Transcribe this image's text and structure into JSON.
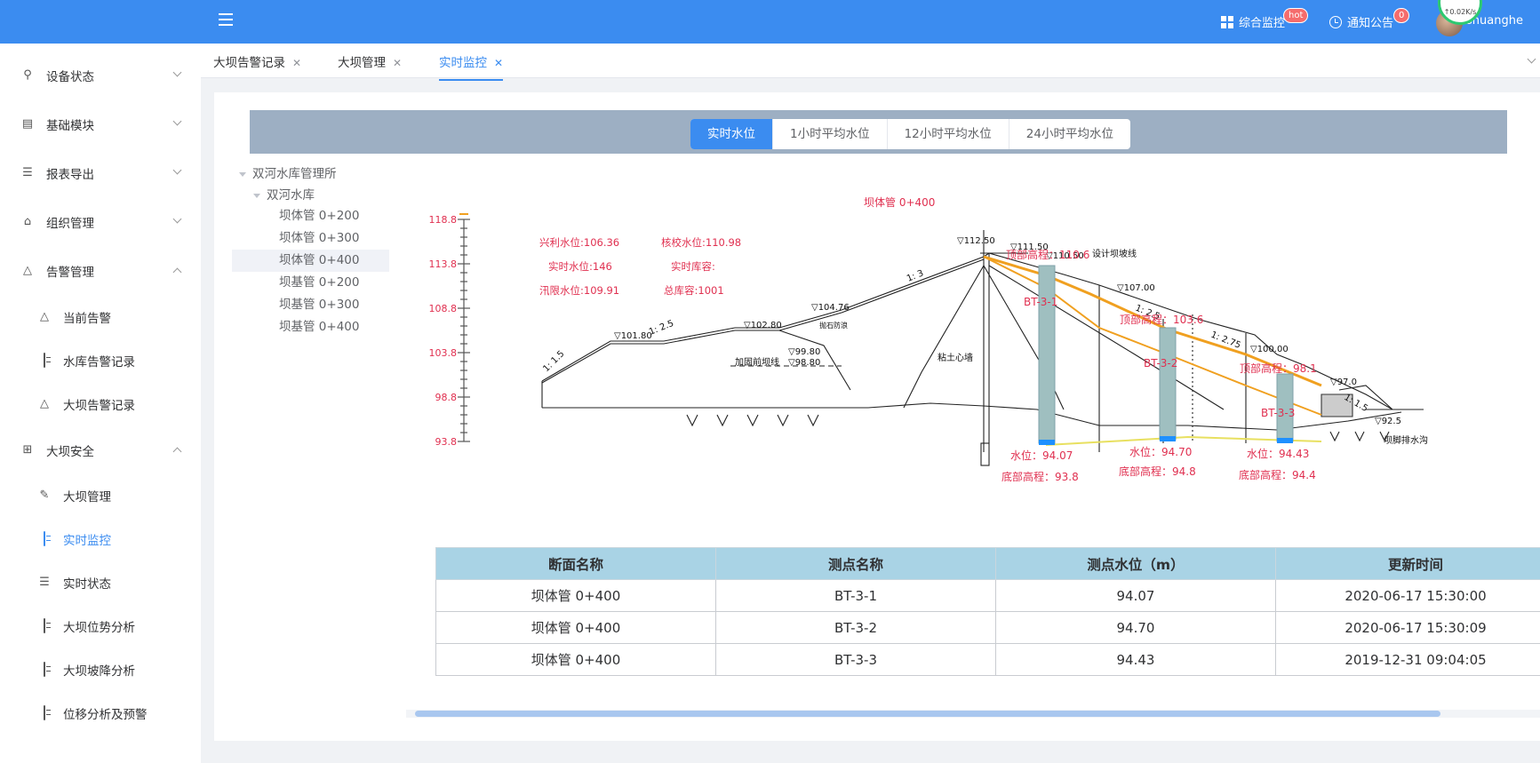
{
  "header": {
    "menu_icon": "hamburger-icon",
    "monitor_label": "综合监控",
    "monitor_badge": "hot",
    "notice_label": "通知公告",
    "notice_badge": "0",
    "username": "shuanghe",
    "net_speed": "↑0.02K/s",
    "brand_color": "#3b8cf0"
  },
  "sidebar": {
    "items": [
      {
        "label": "设备状态",
        "icon": "device-icon"
      },
      {
        "label": "基础模块",
        "icon": "module-icon"
      },
      {
        "label": "报表导出",
        "icon": "list-icon"
      },
      {
        "label": "组织管理",
        "icon": "org-icon"
      },
      {
        "label": "告警管理",
        "icon": "bell-icon"
      },
      {
        "label": "当前告警",
        "icon": "bell-icon"
      },
      {
        "label": "水库告警记录",
        "icon": "doc-icon"
      },
      {
        "label": "大坝告警记录",
        "icon": "bell-icon"
      },
      {
        "label": "大坝安全",
        "icon": "grid-icon"
      },
      {
        "label": "大坝管理",
        "icon": "edit-icon"
      },
      {
        "label": "实时监控",
        "icon": "doc-icon"
      },
      {
        "label": "实时状态",
        "icon": "list-icon"
      },
      {
        "label": "大坝位势分析",
        "icon": "doc-icon"
      },
      {
        "label": "大坝坡降分析",
        "icon": "doc-icon"
      },
      {
        "label": "位移分析及预警",
        "icon": "doc-icon"
      }
    ]
  },
  "tabs": [
    {
      "label": "大坝告警记录"
    },
    {
      "label": "大坝管理"
    },
    {
      "label": "实时监控"
    }
  ],
  "water_tabs": [
    "实时水位",
    "1小时平均水位",
    "12小时平均水位",
    "24小时平均水位"
  ],
  "tree": {
    "root": "双河水库管理所",
    "child": "双河水库",
    "leaves": [
      "坝体管 0+200",
      "坝体管 0+300",
      "坝体管 0+400",
      "坝基管 0+200",
      "坝基管 0+300",
      "坝基管 0+400"
    ]
  },
  "diagram": {
    "title": "坝体管 0+400",
    "scale_ticks": [
      "118.8",
      "113.8",
      "108.8",
      "103.8",
      "98.8",
      "93.8"
    ],
    "info": {
      "xingli": "兴利水位:106.36",
      "jiaohe": "核校水位:110.98",
      "shishi": "实时水位:146",
      "kurong": "实时库容:",
      "xunxian": "汛限水位:109.91",
      "zongkurong": "总库容:1001"
    },
    "pipes": [
      {
        "name": "BT-3-1",
        "water": "水位：94.07",
        "bottom": "底部高程：93.8",
        "top": "顶部高程：110.6"
      },
      {
        "name": "BT-3-2",
        "water": "水位：94.70",
        "bottom": "底部高程：94.8",
        "top": "顶部高程：103.6"
      },
      {
        "name": "BT-3-3",
        "water": "水位：94.43",
        "bottom": "底部高程：94.4",
        "top": "顶部高程：98.1"
      }
    ],
    "drawing_text": {
      "e1": "▽112.50",
      "e2": "▽111.50",
      "e3": "▽110.50",
      "e4": "▽107.00",
      "e5": "▽104.76",
      "e6": "▽102.80",
      "e7": "▽101.80",
      "e8": "▽100.00",
      "e9": "▽97.0",
      "e10": "▽92.5",
      "e11": "▽99.80",
      "e12": "▽98.80",
      "s1": "1: 3",
      "s2": "1: 2.5",
      "s3": "1: 2.5",
      "s4": "1: 2.75",
      "s5": "1: 1.5",
      "s6": "1: 1.5",
      "design": "设计坝坡线",
      "core": "粘土心墙",
      "drain": "坝脚排水沟",
      "berm": "抛石防浪",
      "old_dam": "加固前坝线"
    },
    "pipe_color": "#9fbfc0",
    "water_color": "#1e90ff",
    "seepage_color": "#f0a020",
    "label_color": "#e03050"
  },
  "table": {
    "headers": [
      "断面名称",
      "测点名称",
      "测点水位（m）",
      "更新时间"
    ],
    "rows": [
      [
        "坝体管 0+400",
        "BT-3-1",
        "94.07",
        "2020-06-17 15:30:00"
      ],
      [
        "坝体管 0+400",
        "BT-3-2",
        "94.70",
        "2020-06-17 15:30:09"
      ],
      [
        "坝体管 0+400",
        "BT-3-3",
        "94.43",
        "2019-12-31 09:04:05"
      ]
    ]
  }
}
